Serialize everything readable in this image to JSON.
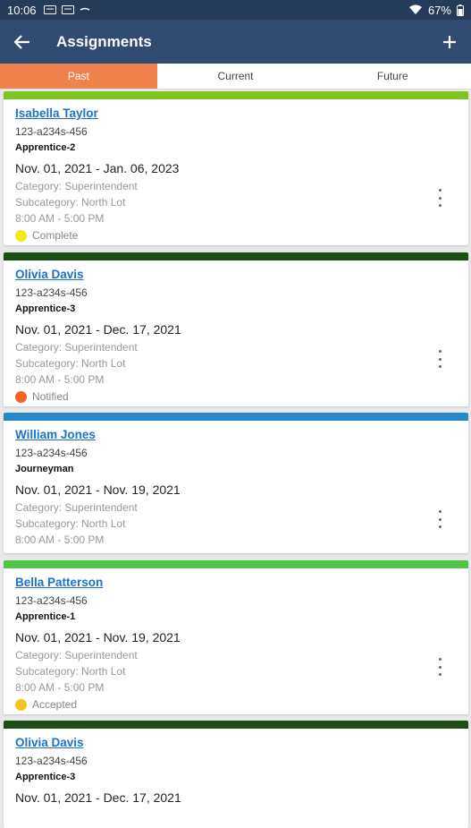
{
  "status_bar": {
    "time": "10:06",
    "battery": "67%"
  },
  "app_bar": {
    "title": "Assignments"
  },
  "tabs": [
    {
      "label": "Past",
      "active": true
    },
    {
      "label": "Current",
      "active": false
    },
    {
      "label": "Future",
      "active": false
    }
  ],
  "cards": [
    {
      "accent": "#7cc521",
      "name": "Isabella Taylor",
      "code": "123-a234s-456",
      "role": "Apprentice-2",
      "dates": "Nov. 01, 2021 - Jan. 06, 2023",
      "category": "Category: Superintendent",
      "subcategory": "Subcategory: North Lot",
      "hours": "8:00 AM - 5:00 PM",
      "status": "Complete",
      "status_color": "#f6e71c"
    },
    {
      "accent": "#1e4d1a",
      "name": "Olivia Davis",
      "code": "123-a234s-456",
      "role": "Apprentice-3",
      "dates": "Nov. 01, 2021 - Dec. 17, 2021",
      "category": "Category: Superintendent",
      "subcategory": "Subcategory: North Lot",
      "hours": "8:00 AM - 5:00 PM",
      "status": "Notified",
      "status_color": "#f26522"
    },
    {
      "accent": "#2a88c9",
      "name": "William Jones",
      "code": "123-a234s-456",
      "role": "Journeyman",
      "dates": "Nov. 01, 2021 - Nov. 19, 2021",
      "category": "Category: Superintendent",
      "subcategory": "Subcategory: North Lot",
      "hours": "8:00 AM - 5:00 PM",
      "status": "",
      "status_color": ""
    },
    {
      "accent": "#4cc54a",
      "name": "Bella Patterson",
      "code": "123-a234s-456",
      "role": "Apprentice-1",
      "dates": "Nov. 01, 2021 - Nov. 19, 2021",
      "category": "Category: Superintendent",
      "subcategory": "Subcategory: North Lot",
      "hours": "8:00 AM - 5:00 PM",
      "status": "Accepted",
      "status_color": "#f5c518"
    },
    {
      "accent": "#1e4d1a",
      "name": "Olivia Davis",
      "code": "123-a234s-456",
      "role": "Apprentice-3",
      "dates": "Nov. 01, 2021 - Dec. 17, 2021",
      "category": "",
      "subcategory": "",
      "hours": "",
      "status": "",
      "status_color": ""
    }
  ],
  "icons": {
    "back": "arrow-left-icon",
    "add": "plus-icon",
    "more": "more-vertical-icon",
    "wifi": "wifi-icon",
    "battery": "battery-icon"
  }
}
